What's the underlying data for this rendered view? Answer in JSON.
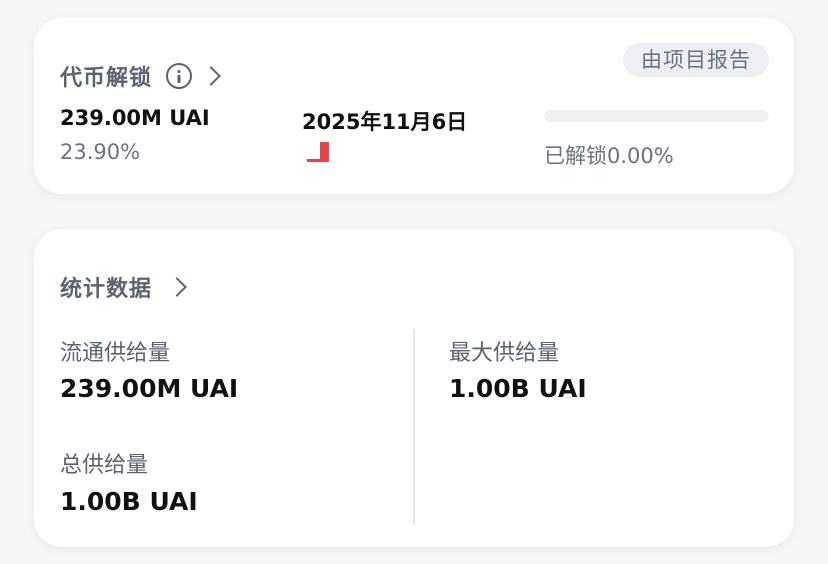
{
  "unlock_card": {
    "title": "代币解锁",
    "badge": "由项目报告",
    "amount": "239.00M UAI",
    "percent": "23.90%",
    "date": "2025年11月6日",
    "unlocked_label": "已解锁0.00%",
    "unlocked_progress_percent": 0,
    "marker_color": "#e0474c"
  },
  "stats_card": {
    "title": "统计数据",
    "circulating_label": "流通供给量",
    "circulating_value": "239.00M UAI",
    "max_label": "最大供给量",
    "max_value": "1.00B UAI",
    "total_label": "总供给量",
    "total_value": "1.00B UAI"
  },
  "icons": {
    "info": "info-icon",
    "chevron": "chevron-right-icon"
  }
}
